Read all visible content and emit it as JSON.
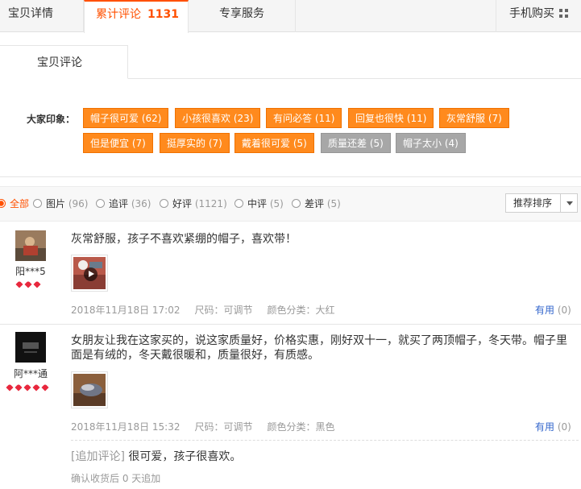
{
  "tabs": {
    "detail": "宝贝详情",
    "review_label": "累计评论",
    "review_count": "1131",
    "service": "专享服务",
    "mobile": "手机购买"
  },
  "sub_tab": "宝贝评论",
  "impressions": {
    "label": "大家印象：",
    "tags": [
      {
        "text": "帽子很可爱 (62)",
        "color": "#ff8a1d"
      },
      {
        "text": "小孩很喜欢 (23)",
        "color": "#ff8a1d"
      },
      {
        "text": "有问必答 (11)",
        "color": "#ff8a1d"
      },
      {
        "text": "回复也很快 (11)",
        "color": "#ff8a1d"
      },
      {
        "text": "灰常舒服 (7)",
        "color": "#ff8a1d"
      },
      {
        "text": "但是便宜 (7)",
        "color": "#ff8a1d"
      },
      {
        "text": "挺厚实的 (7)",
        "color": "#ff8a1d"
      },
      {
        "text": "戴着很可爱 (5)",
        "color": "#ff8a1d"
      },
      {
        "text": "质量还差 (5)",
        "color": "#a7a7a7"
      },
      {
        "text": "帽子太小 (4)",
        "color": "#a7a7a7"
      }
    ]
  },
  "filters": [
    {
      "label": "全部",
      "count": "",
      "selected": true
    },
    {
      "label": "图片",
      "count": "(96)"
    },
    {
      "label": "追评",
      "count": "(36)"
    },
    {
      "label": "好评",
      "count": "(1121)"
    },
    {
      "label": "中评",
      "count": "(5)"
    },
    {
      "label": "差评",
      "count": "(5)"
    }
  ],
  "sort": {
    "label": "推荐排序"
  },
  "reviews": [
    {
      "user": "阳***5",
      "hearts": 3,
      "text": "灰常舒服，孩子不喜欢紧绷的帽子，喜欢带！",
      "date": "2018年11月18日 17:02",
      "size": "尺码：可调节",
      "color": "颜色分类：大红",
      "useful_label": "有用",
      "useful_count": "(0)"
    },
    {
      "user": "阿***通",
      "hearts": 5,
      "text": "女朋友让我在这家买的，说这家质量好，价格实惠，刚好双十一，就买了两顶帽子，冬天带。帽子里面是有绒的，冬天戴很暖和，质量很好，有质感。",
      "date": "2018年11月18日 15:32",
      "size": "尺码：可调节",
      "color": "颜色分类：黑色",
      "useful_label": "有用",
      "useful_count": "(0)",
      "append_tag": "[追加评论]",
      "append_text": "很可爱，孩子很喜欢。",
      "append_meta": "确认收货后 0 天追加"
    }
  ],
  "colors": {
    "accent": "#ff5000",
    "link": "#3366cc",
    "heart": "#e8273d"
  }
}
